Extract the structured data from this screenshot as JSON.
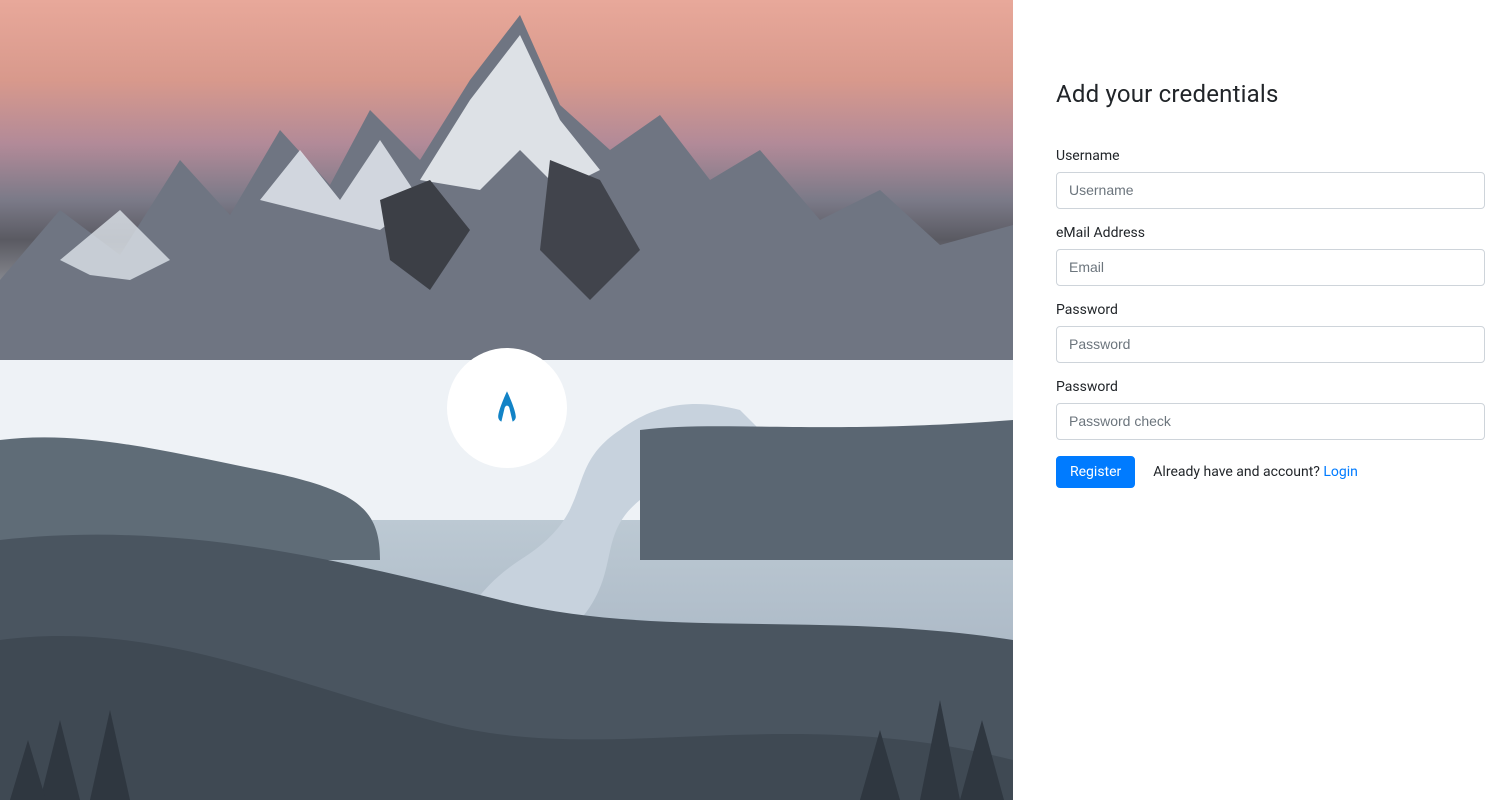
{
  "form": {
    "title": "Add your credentials",
    "fields": {
      "username": {
        "label": "Username",
        "placeholder": "Username"
      },
      "email": {
        "label": "eMail Address",
        "placeholder": "Email"
      },
      "password": {
        "label": "Password",
        "placeholder": "Password"
      },
      "password_check": {
        "label": "Password",
        "placeholder": "Password check"
      }
    },
    "submit_label": "Register",
    "already_text": "Already have and account? ",
    "login_link": "Login"
  }
}
